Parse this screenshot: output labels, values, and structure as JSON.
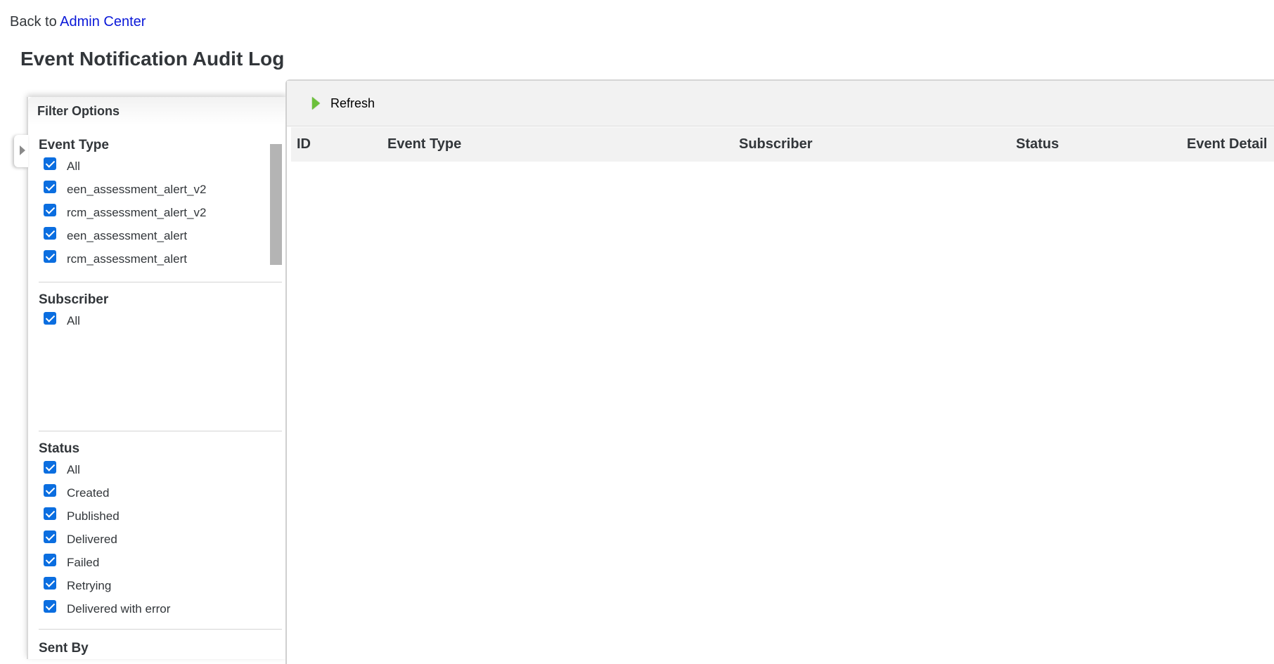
{
  "nav": {
    "back_prefix": "Back to",
    "back_link": "Admin Center"
  },
  "page": {
    "title": "Event Notification Audit Log"
  },
  "filter": {
    "header": "Filter Options",
    "event_type": {
      "title": "Event Type",
      "options": [
        "All",
        "een_assessment_alert_v2",
        "rcm_assessment_alert_v2",
        "een_assessment_alert",
        "rcm_assessment_alert"
      ]
    },
    "subscriber": {
      "title": "Subscriber",
      "options": [
        "All"
      ]
    },
    "status": {
      "title": "Status",
      "options": [
        "All",
        "Created",
        "Published",
        "Delivered",
        "Failed",
        "Retrying",
        "Delivered with error"
      ]
    },
    "sent_by": {
      "title": "Sent By"
    }
  },
  "toolbar": {
    "refresh_label": "Refresh"
  },
  "table": {
    "columns": [
      "ID",
      "Event Type",
      "Subscriber",
      "Status",
      "Event Detail"
    ]
  },
  "colors": {
    "link": "#0a18d8",
    "checkbox": "#0b6ee0",
    "refresh_icon": "#6cc03a"
  }
}
